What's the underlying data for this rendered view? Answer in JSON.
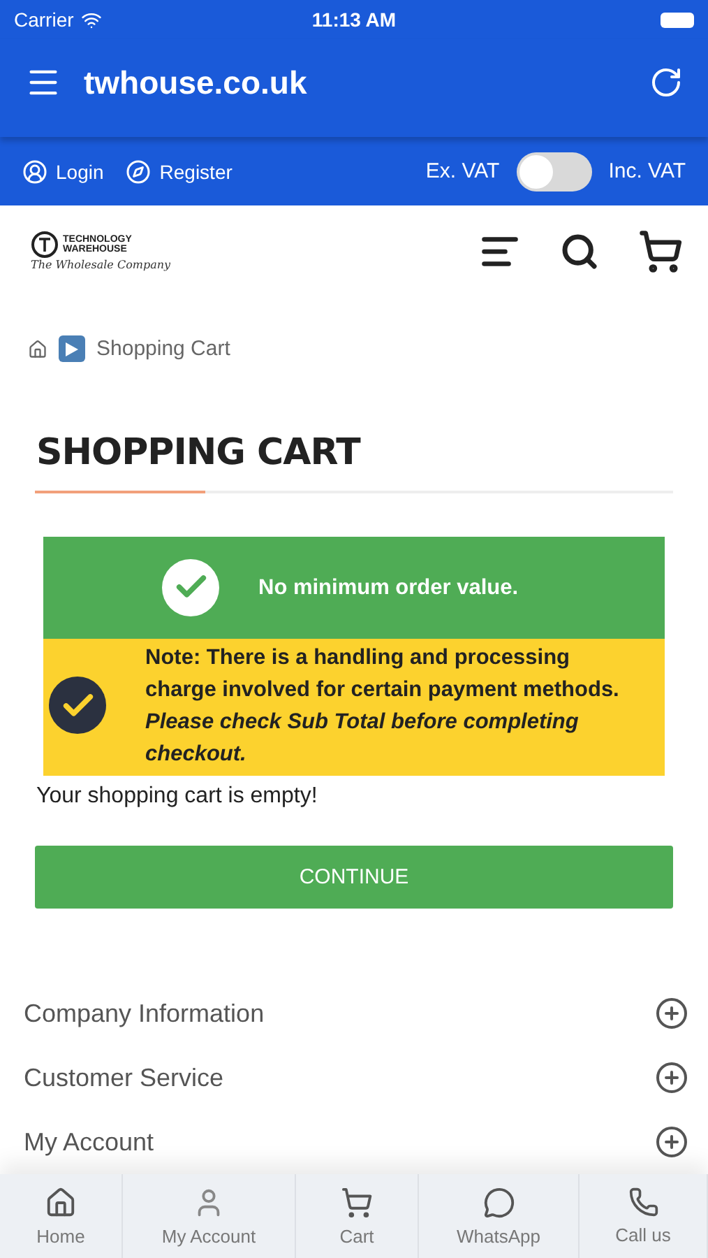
{
  "status_bar": {
    "carrier": "Carrier",
    "time": "11:13 AM"
  },
  "app_bar": {
    "title": "twhouse.co.uk"
  },
  "account_bar": {
    "login": "Login",
    "register": "Register",
    "vat_left": "Ex. VAT",
    "vat_right": "Inc. VAT",
    "vat_toggle": {
      "on": false
    }
  },
  "logo": {
    "line_1": "TECHNOLOGY",
    "line_2": "WAREHOUSE",
    "tagline": "The Wholesale Company"
  },
  "breadcrumb": {
    "current": "Shopping Cart"
  },
  "heading": "SHOPPING CART",
  "notices": [
    {
      "kind": "success",
      "text": "No minimum order value."
    },
    {
      "kind": "warning",
      "text": "Note: There is a handling and processing charge involved for certain payment methods.",
      "emphasis": "Please check Sub Total before completing checkout."
    }
  ],
  "empty_message": "Your shopping cart is empty!",
  "continue_button": "CONTINUE",
  "footer_sections": [
    {
      "label": "Company Information",
      "expanded": false
    },
    {
      "label": "Customer Service",
      "expanded": false
    },
    {
      "label": "My Account",
      "expanded": false
    }
  ],
  "bottom_nav": [
    {
      "kind": "home",
      "label": "Home"
    },
    {
      "kind": "account",
      "label": "My Account"
    },
    {
      "kind": "cart",
      "label": "Cart"
    },
    {
      "kind": "whatsapp",
      "label": "WhatsApp"
    },
    {
      "kind": "phone",
      "label": "Call us"
    }
  ]
}
